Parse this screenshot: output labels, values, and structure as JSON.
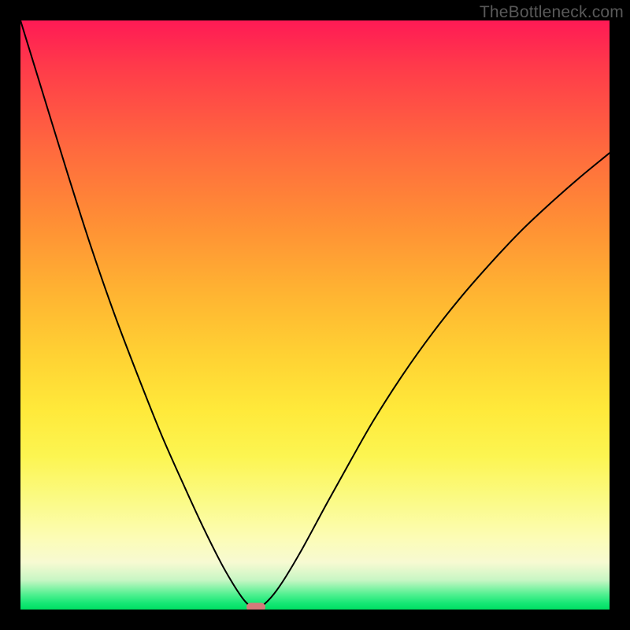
{
  "watermark": "TheBottleneck.com",
  "chart_data": {
    "type": "line",
    "title": "",
    "xlabel": "",
    "ylabel": "",
    "xlim": [
      0,
      100
    ],
    "ylim": [
      0,
      100
    ],
    "curve_points": [
      {
        "x": 0.0,
        "y": 100.0
      },
      {
        "x": 4.0,
        "y": 87.0
      },
      {
        "x": 8.0,
        "y": 74.0
      },
      {
        "x": 12.0,
        "y": 61.5
      },
      {
        "x": 16.0,
        "y": 50.0
      },
      {
        "x": 20.0,
        "y": 39.5
      },
      {
        "x": 24.0,
        "y": 29.5
      },
      {
        "x": 28.0,
        "y": 20.5
      },
      {
        "x": 31.0,
        "y": 14.0
      },
      {
        "x": 34.0,
        "y": 8.0
      },
      {
        "x": 36.0,
        "y": 4.5
      },
      {
        "x": 37.5,
        "y": 2.2
      },
      {
        "x": 38.5,
        "y": 1.0
      },
      {
        "x": 39.5,
        "y": 0.3
      },
      {
        "x": 40.5,
        "y": 0.3
      },
      {
        "x": 41.5,
        "y": 1.0
      },
      {
        "x": 43.0,
        "y": 2.6
      },
      {
        "x": 45.0,
        "y": 5.5
      },
      {
        "x": 48.0,
        "y": 10.6
      },
      {
        "x": 52.0,
        "y": 18.0
      },
      {
        "x": 56.0,
        "y": 25.2
      },
      {
        "x": 60.0,
        "y": 32.2
      },
      {
        "x": 65.0,
        "y": 40.0
      },
      {
        "x": 70.0,
        "y": 47.0
      },
      {
        "x": 75.0,
        "y": 53.3
      },
      {
        "x": 80.0,
        "y": 59.0
      },
      {
        "x": 85.0,
        "y": 64.3
      },
      {
        "x": 90.0,
        "y": 69.0
      },
      {
        "x": 95.0,
        "y": 73.4
      },
      {
        "x": 100.0,
        "y": 77.5
      }
    ],
    "marker": {
      "x": 40.0,
      "y": 0.0,
      "color": "#d47a7a"
    },
    "gradient_stops": [
      {
        "pos": 0.0,
        "color": "#ff1a55"
      },
      {
        "pos": 0.22,
        "color": "#ff6a3e"
      },
      {
        "pos": 0.46,
        "color": "#ffb332"
      },
      {
        "pos": 0.66,
        "color": "#ffe93a"
      },
      {
        "pos": 0.82,
        "color": "#fbfb8a"
      },
      {
        "pos": 0.92,
        "color": "#f7fad2"
      },
      {
        "pos": 0.975,
        "color": "#4ef08f"
      },
      {
        "pos": 1.0,
        "color": "#00df63"
      }
    ]
  }
}
